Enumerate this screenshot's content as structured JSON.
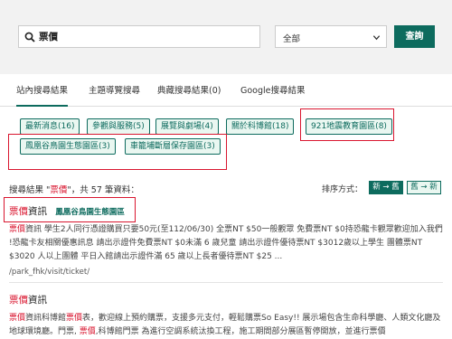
{
  "search": {
    "query": "票價",
    "scope_selected": "全部",
    "button_label": "查詢"
  },
  "tabs": [
    {
      "label": "站內搜尋結果",
      "active": true
    },
    {
      "label": "主題導覽搜尋",
      "active": false
    },
    {
      "label": "典藏搜尋結果(0)",
      "active": false
    },
    {
      "label": "Google搜尋結果",
      "active": false
    }
  ],
  "categories": [
    {
      "label": "最新消息(16)"
    },
    {
      "label": "參觀與服務(5)"
    },
    {
      "label": "展覽與劇場(4)"
    },
    {
      "label": "關於科博館(18)"
    },
    {
      "label": "921地震教育園區(8)"
    },
    {
      "label": "鳳凰谷鳥園生態園區(3)"
    },
    {
      "label": "車籠埔斷層保存園區(3)"
    }
  ],
  "summary": {
    "prefix": "搜尋結果 \"",
    "keyword": "票價",
    "suffix": "\"，共 57 筆資料："
  },
  "sort": {
    "label": "排序方式：",
    "new_to_old": "新 → 舊",
    "old_to_new": "舊 → 新"
  },
  "results": [
    {
      "title_kw": "票價",
      "title_rest": "資訊",
      "tag": "鳳凰谷鳥園生態園區",
      "snippet_kw": "票價",
      "snippet_text": "資訊 學生2人同行憑證購買只要50元(至112/06/30) 全票NT $50一般觀眾 免費票NT $0持恐龍卡觀眾歡迎加入我們 !恐龍卡友相關優惠訊息 請出示證件免費票NT $0未滿 6 歲兒童 請出示證件優待票NT $3012歲以上學生 團體票NT $3020 人以上團體 平日入館請出示證件滿 65 歲以上長者優待票NT $25 ...",
      "url": "/park_fhk/visit/ticket/"
    },
    {
      "title_kw": "票價",
      "title_rest": "資訊",
      "snippet_kw": "票價",
      "snippet_text": "資訊科博館",
      "snippet_kw2": "票價",
      "snippet_text2": "表，歡迎線上預約購票，支援多元支付，輕鬆購票So Easy!! 展示場包含生命科學廳、人類文化廳及地球環境廳。門票, ",
      "snippet_kw3": "票價",
      "snippet_text3": ",科博館門票 為進行空調系統汰換工程，施工期間部分展區暫停開放，並進行票價"
    }
  ]
}
